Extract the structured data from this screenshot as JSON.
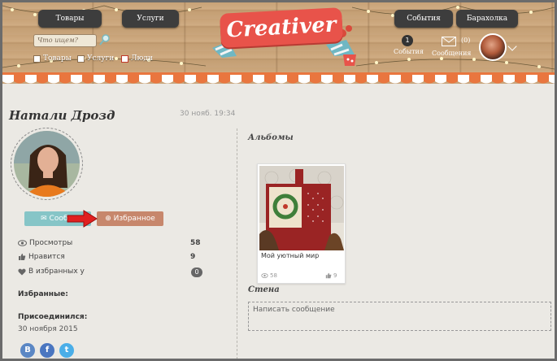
{
  "header": {
    "nav_left": [
      "Товары",
      "Услуги"
    ],
    "nav_right": [
      "События",
      "Барахолка"
    ],
    "search_placeholder": "Что ищем?",
    "filters": [
      "Товары",
      "Услуги",
      "Люди"
    ],
    "logo_text": "Creativer",
    "events_count": "1",
    "events_label": "События",
    "messages_count": "(0)",
    "messages_label": "Сообщения"
  },
  "profile": {
    "name": "Натали Дрозд",
    "time": "30 нояб. 19:34",
    "message_button": "Сообщ",
    "favorite_button": "Избранное",
    "stats": [
      {
        "icon": "eye-icon",
        "label": "Просмотры",
        "value": "58"
      },
      {
        "icon": "thumbs-up-icon",
        "label": "Нравится",
        "value": "9"
      },
      {
        "icon": "heart-icon",
        "label": "В избранных у",
        "value": "0"
      }
    ],
    "favorites_label": "Избранные:",
    "joined_label": "Присоединился:",
    "joined_date": "30 ноября 2015",
    "social": [
      {
        "name": "vk",
        "letter": "В",
        "color": "#5b87c4"
      },
      {
        "name": "facebook",
        "letter": "f",
        "color": "#4a76c0"
      },
      {
        "name": "twitter",
        "letter": "t",
        "color": "#4aaee8"
      }
    ]
  },
  "albums": {
    "title": "Альбомы",
    "items": [
      {
        "name": "Мой уютный мир",
        "views": "58",
        "likes": "9"
      }
    ]
  },
  "wall": {
    "title": "Стена",
    "placeholder": "Написать сообщение"
  },
  "colors": {
    "accent_red": "#e8534a",
    "message_button": "#86c5c7",
    "favorite_button": "#c7876c"
  }
}
